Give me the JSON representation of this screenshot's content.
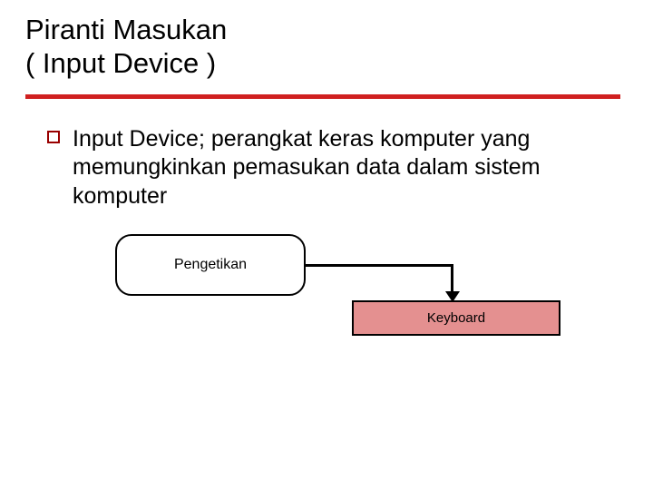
{
  "title_line1": "Piranti Masukan",
  "title_line2": "( Input Device )",
  "bullet_text": "Input Device; perangkat keras komputer yang memungkinkan pemasukan data dalam sistem komputer",
  "node_typing": "Pengetikan",
  "node_keyboard": "Keyboard"
}
